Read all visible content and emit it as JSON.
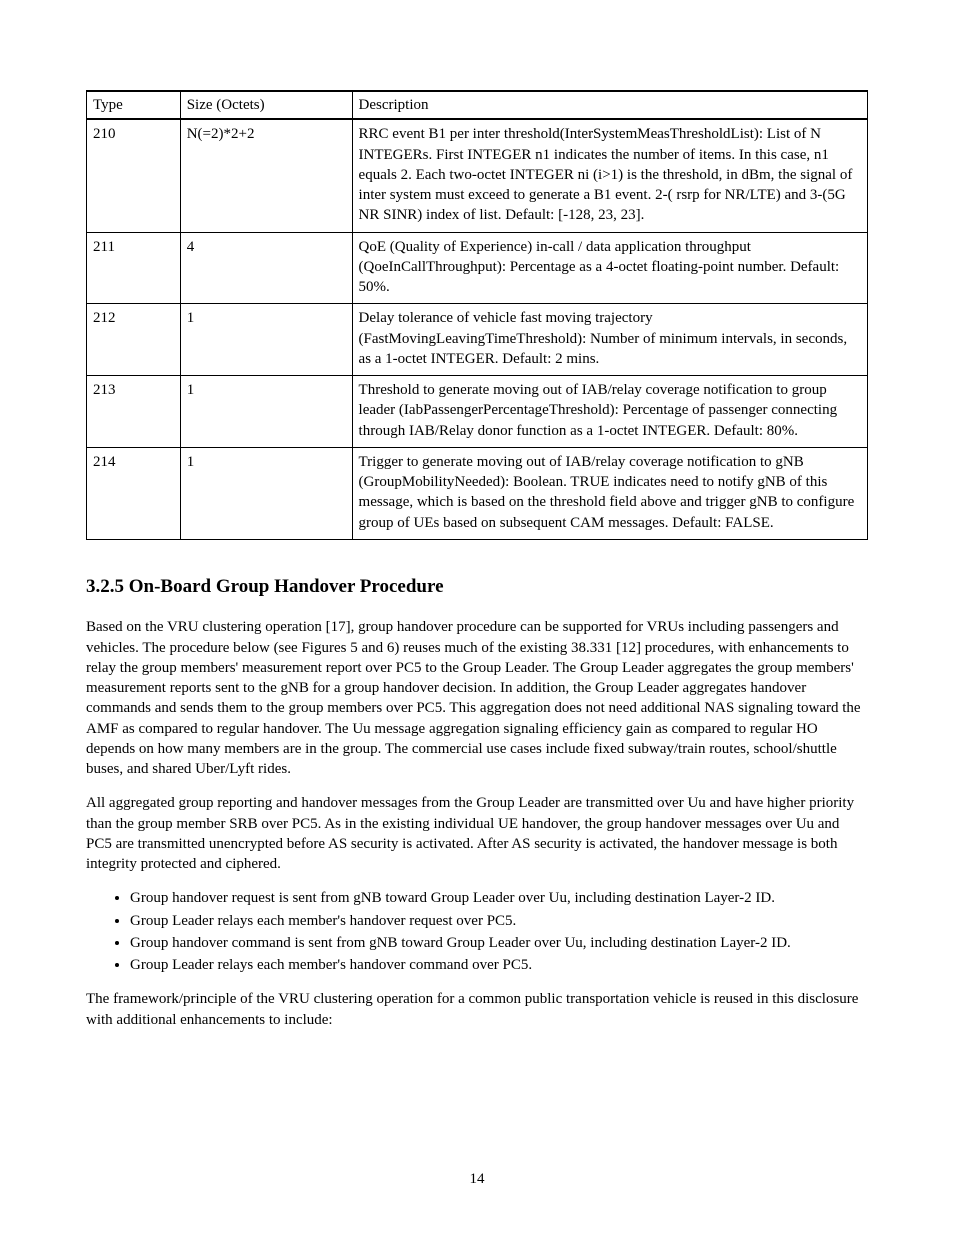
{
  "table": {
    "headers": [
      "Type",
      "Size (Octets)",
      "Description"
    ],
    "rows": [
      {
        "type": "210",
        "size": "N(=2)*2+2",
        "desc": "RRC event B1 per inter threshold(InterSystemMeasThresholdList): List of N INTEGERs. First INTEGER n1 indicates the number of items. In this case, n1 equals 2. Each two-octet INTEGER ni (i>1) is the threshold, in dBm, the signal of inter system must exceed to generate a B1 event. 2-( rsrp for NR/LTE) and 3-(5G NR SINR) index of list. Default: [-128, 23, 23]."
      },
      {
        "type": "211",
        "size": "4",
        "desc": "QoE (Quality of Experience) in-call / data application throughput (QoeInCallThroughput): Percentage as a 4-octet floating-point number. Default: 50%."
      },
      {
        "type": "212",
        "size": "1",
        "desc": "Delay tolerance of vehicle fast moving trajectory (FastMovingLeavingTimeThreshold): Number of minimum intervals, in seconds, as a 1-octet INTEGER. Default: 2 mins."
      },
      {
        "type": "213",
        "size": "1",
        "desc": "Threshold to generate moving out of IAB/relay coverage notification to group leader (IabPassengerPercentageThreshold): Percentage of passenger connecting through IAB/Relay donor function as a 1-octet INTEGER. Default: 80%."
      },
      {
        "type": "214",
        "size": "1",
        "desc": "Trigger to generate moving out of IAB/relay coverage notification to gNB (GroupMobilityNeeded): Boolean. TRUE indicates need to notify gNB of this message, which is based on the threshold field above and trigger gNB to configure group of UEs based on subsequent CAM messages. Default: FALSE."
      }
    ]
  },
  "section_title": "3.2.5 On-Board Group Handover Procedure",
  "paragraphs": [
    "Based on the VRU clustering operation [17], group handover procedure can be supported for VRUs including passengers and vehicles. The procedure below (see Figures 5 and 6) reuses much of the existing 38.331 [12] procedures, with enhancements to relay the group members' measurement report over PC5 to the Group Leader. The Group Leader aggregates the group members' measurement reports sent to the gNB for a group handover decision. In addition, the Group Leader aggregates handover commands and sends them to the group members over PC5. This aggregation does not need additional NAS signaling toward the AMF as compared to regular handover. The Uu message aggregation signaling efficiency gain as compared to regular HO depends on how many members are in the group. The commercial use cases include fixed subway/train routes, school/shuttle buses, and shared Uber/Lyft rides.",
    "All aggregated group reporting and handover messages from the Group Leader are transmitted over Uu and have higher priority than the group member SRB over PC5. As in the existing individual UE handover, the group handover messages over Uu and PC5 are transmitted unencrypted before AS security is activated. After AS security is activated, the handover message is both integrity protected and ciphered."
  ],
  "list": [
    "Group handover request is sent from gNB toward Group Leader over Uu, including destination Layer-2 ID.",
    "Group Leader relays each member's handover request over PC5.",
    "Group handover command is sent from gNB toward Group Leader over Uu, including destination Layer-2 ID.",
    "Group Leader relays each member's handover command over PC5."
  ],
  "post_paragraph": "The framework/principle of the VRU clustering operation for a common public transportation vehicle is reused in this disclosure with additional enhancements to include:",
  "page_number": "14"
}
